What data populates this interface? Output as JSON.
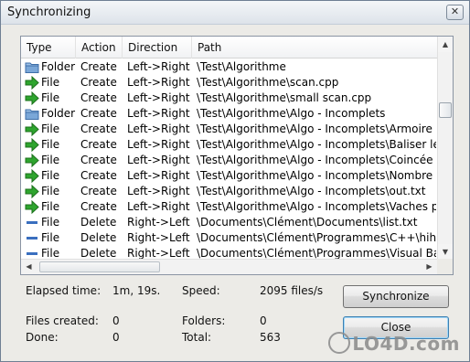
{
  "window": {
    "title": "Synchronizing",
    "close_label": "✕"
  },
  "columns": [
    "Type",
    "Action",
    "Direction",
    "Path"
  ],
  "rows": [
    {
      "type": "Folder",
      "icon": "folder-icon",
      "action": "Create",
      "direction": "Left->Right",
      "path": "\\Test\\Algorithme"
    },
    {
      "type": "File",
      "icon": "green-arrow-icon",
      "action": "Create",
      "direction": "Left->Right",
      "path": "\\Test\\Algorithme\\scan.cpp"
    },
    {
      "type": "File",
      "icon": "green-arrow-icon",
      "action": "Create",
      "direction": "Left->Right",
      "path": "\\Test\\Algorithme\\small scan.cpp"
    },
    {
      "type": "Folder",
      "icon": "folder-icon",
      "action": "Create",
      "direction": "Left->Right",
      "path": "\\Test\\Algorithme\\Algo - Incomplets"
    },
    {
      "type": "File",
      "icon": "green-arrow-icon",
      "action": "Create",
      "direction": "Left->Right",
      "path": "\\Test\\Algorithme\\Algo - Incomplets\\Armoire de"
    },
    {
      "type": "File",
      "icon": "green-arrow-icon",
      "action": "Create",
      "direction": "Left->Right",
      "path": "\\Test\\Algorithme\\Algo - Incomplets\\Baliser le"
    },
    {
      "type": "File",
      "icon": "green-arrow-icon",
      "action": "Create",
      "direction": "Left->Right",
      "path": "\\Test\\Algorithme\\Algo - Incomplets\\Coincée d"
    },
    {
      "type": "File",
      "icon": "green-arrow-icon",
      "action": "Create",
      "direction": "Left->Right",
      "path": "\\Test\\Algorithme\\Algo - Incomplets\\Nombre d"
    },
    {
      "type": "File",
      "icon": "green-arrow-icon",
      "action": "Create",
      "direction": "Left->Right",
      "path": "\\Test\\Algorithme\\Algo - Incomplets\\out.txt"
    },
    {
      "type": "File",
      "icon": "green-arrow-icon",
      "action": "Create",
      "direction": "Left->Right",
      "path": "\\Test\\Algorithme\\Algo - Incomplets\\Vaches pl"
    },
    {
      "type": "File",
      "icon": "delete-dash-icon",
      "action": "Delete",
      "direction": "Right->Left",
      "path": "\\Documents\\Clément\\Documents\\list.txt"
    },
    {
      "type": "File",
      "icon": "delete-dash-icon",
      "action": "Delete",
      "direction": "Right->Left",
      "path": "\\Documents\\Clément\\Programmes\\C++\\hih.e"
    },
    {
      "type": "File",
      "icon": "delete-dash-icon",
      "action": "Delete",
      "direction": "Right->Left",
      "path": "\\Documents\\Clément\\Programmes\\Visual Bas"
    }
  ],
  "stats": {
    "elapsed_label": "Elapsed time:",
    "elapsed_value": "1m, 19s.",
    "speed_label": "Speed:",
    "speed_value": "2095 files/s",
    "files_created_label": "Files created:",
    "files_created_value": "0",
    "folders_label": "Folders:",
    "folders_value": "0",
    "done_label": "Done:",
    "done_value": "0",
    "total_label": "Total:",
    "total_value": "563"
  },
  "buttons": {
    "synchronize": "Synchronize",
    "close": "Close"
  },
  "watermark": "LO4D.com",
  "colors": {
    "arrow_green": "#2ea52e",
    "delete_blue": "#3a6fbf",
    "folder_blue": "#7aa7d8"
  }
}
